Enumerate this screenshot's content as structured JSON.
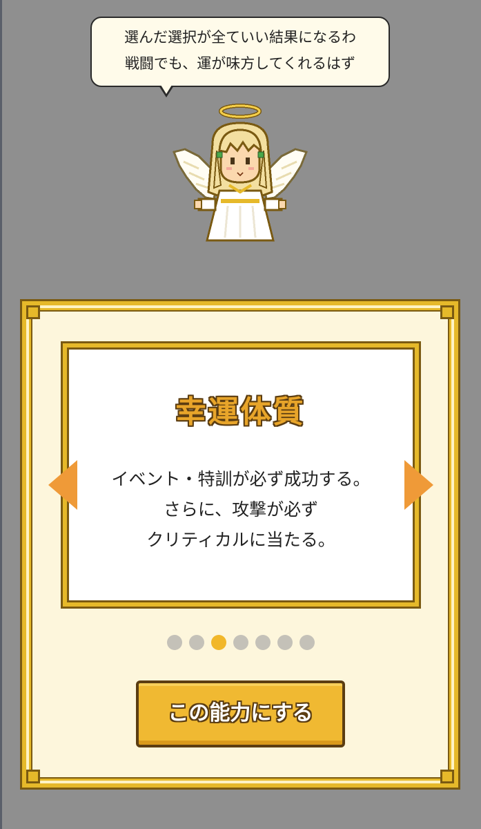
{
  "speech_bubble": {
    "line1": "選んだ選択が全ていい結果になるわ",
    "line2": "戦闘でも、運が味方してくれるはず"
  },
  "ability": {
    "title": "幸運体質",
    "description": [
      "イベント・特訓が必ず成功する。",
      "さらに、攻撃が必ず",
      "クリティカルに当たる。"
    ]
  },
  "pagination": {
    "total": 7,
    "current_index": 2
  },
  "choose_button_label": "この能力にする",
  "colors": {
    "background": "#8f8f8f",
    "panel": "#fdf6dc",
    "gold": "#e6b92a",
    "arrow": "#ef9a38",
    "dot_active": "#f1b72a",
    "dot_inactive": "#c4c1b8"
  },
  "icons": {
    "character": "angel-character",
    "prev": "arrow-left-icon",
    "next": "arrow-right-icon"
  }
}
